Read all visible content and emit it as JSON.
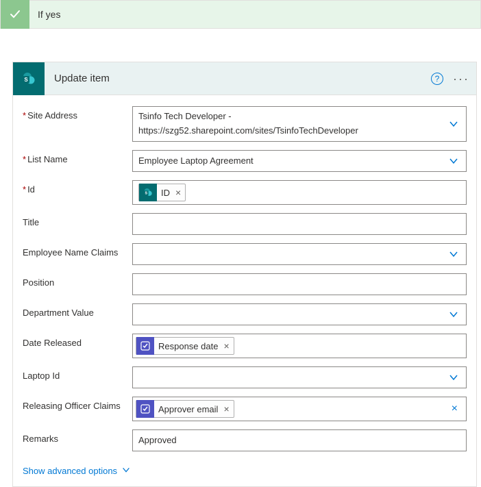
{
  "condition": {
    "title": "If yes"
  },
  "action": {
    "title": "Update item",
    "icon_name": "sharepoint-icon"
  },
  "fields": {
    "site_address": {
      "label": "Site Address",
      "line1": "Tsinfo Tech Developer -",
      "line2": "https://szg52.sharepoint.com/sites/TsinfoTechDeveloper"
    },
    "list_name": {
      "label": "List Name",
      "value": "Employee Laptop Agreement"
    },
    "id": {
      "label": "Id",
      "token": "ID"
    },
    "title": {
      "label": "Title"
    },
    "employee_name": {
      "label": "Employee Name Claims"
    },
    "position": {
      "label": "Position"
    },
    "department": {
      "label": "Department Value"
    },
    "date_released": {
      "label": "Date Released",
      "token": "Response date"
    },
    "laptop_id": {
      "label": "Laptop Id"
    },
    "releasing_officer": {
      "label": "Releasing Officer Claims",
      "token": "Approver email"
    },
    "remarks": {
      "label": "Remarks",
      "value": "Approved"
    }
  },
  "footer": {
    "show_advanced": "Show advanced options"
  }
}
